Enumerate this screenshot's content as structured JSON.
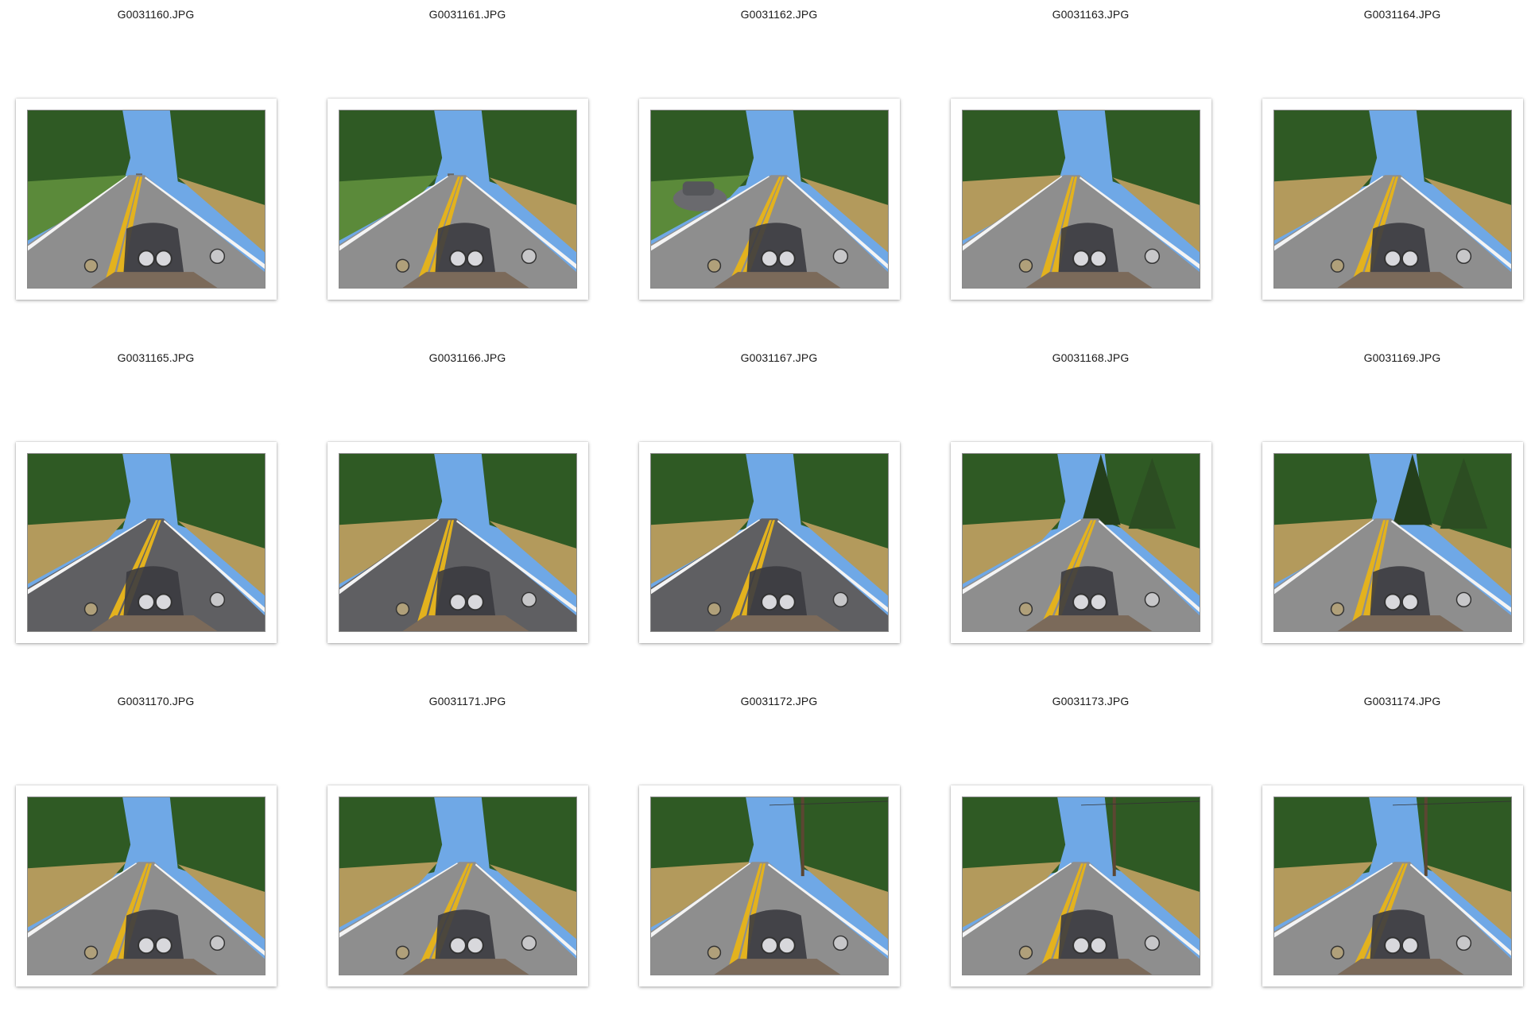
{
  "files": [
    {
      "name": "G0031160.JPG",
      "scene": "sunny-road-car-far"
    },
    {
      "name": "G0031161.JPG",
      "scene": "sunny-road-car-far"
    },
    {
      "name": "G0031162.JPG",
      "scene": "oncoming-car"
    },
    {
      "name": "G0031163.JPG",
      "scene": "curve-trees"
    },
    {
      "name": "G0031164.JPG",
      "scene": "curve-trees"
    },
    {
      "name": "G0031165.JPG",
      "scene": "shaded-curve"
    },
    {
      "name": "G0031166.JPG",
      "scene": "shaded-curve"
    },
    {
      "name": "G0031167.JPG",
      "scene": "shaded-curve"
    },
    {
      "name": "G0031168.JPG",
      "scene": "tall-pines"
    },
    {
      "name": "G0031169.JPG",
      "scene": "tall-pines"
    },
    {
      "name": "G0031170.JPG",
      "scene": "open-road"
    },
    {
      "name": "G0031171.JPG",
      "scene": "open-road"
    },
    {
      "name": "G0031172.JPG",
      "scene": "power-pole"
    },
    {
      "name": "G0031173.JPG",
      "scene": "power-pole"
    },
    {
      "name": "G0031174.JPG",
      "scene": "power-pole"
    }
  ],
  "colors": {
    "sky": "#6fa8e6",
    "trees": "#2f5a24",
    "trees_light": "#5b8a3a",
    "dry_grass": "#b39a5c",
    "road": "#8e8e8e",
    "road_dark": "#5f5f62",
    "lane_yellow": "#e3b21e",
    "edge_white": "#f4f4f4"
  }
}
